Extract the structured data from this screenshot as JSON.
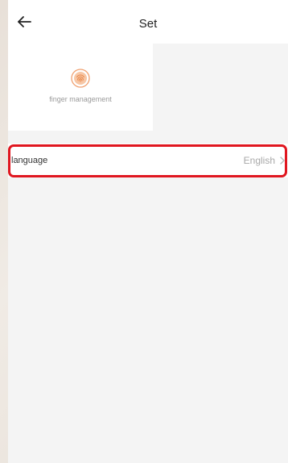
{
  "header": {
    "title": "Set",
    "back_icon": "arrow-left-icon"
  },
  "tiles": [
    {
      "label": "finger management",
      "icon": "fingerprint-icon",
      "icon_color": "#f0a070"
    }
  ],
  "settings": {
    "language": {
      "label": "language",
      "value": "English",
      "icon": "chevron-right-icon"
    }
  },
  "colors": {
    "highlight": "#e0161f",
    "background": "#f4f4f4",
    "accent": "#f0a070"
  }
}
